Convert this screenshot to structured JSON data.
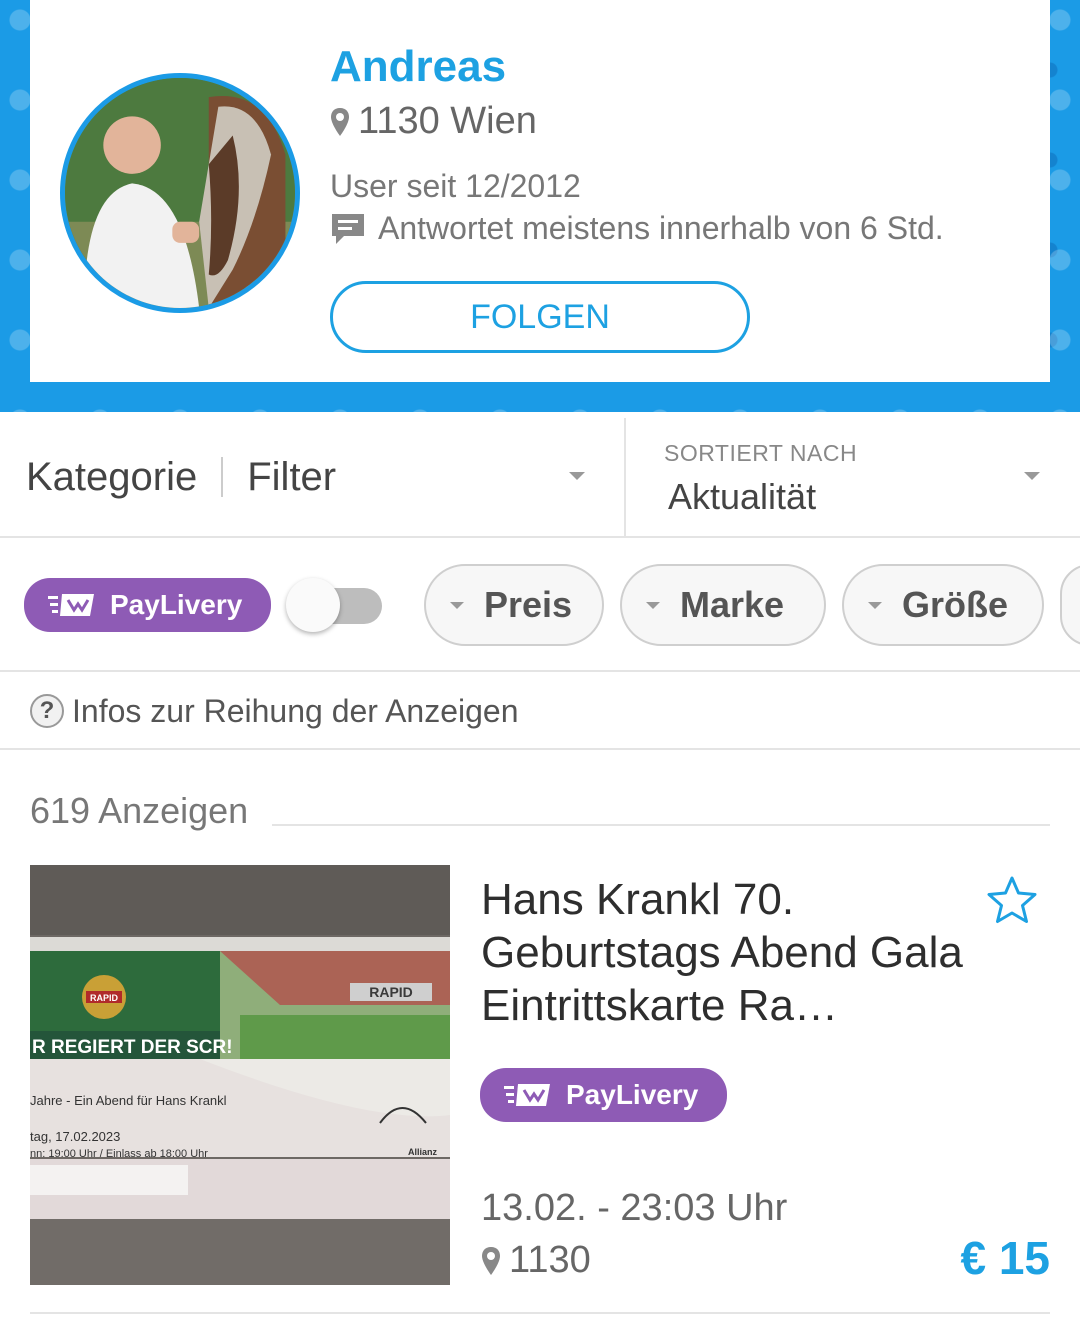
{
  "profile": {
    "name": "Andreas",
    "location": "1130 Wien",
    "member_since": "User seit 12/2012",
    "response_time": "Antwortet meistens innerhalb von 6 Std.",
    "follow_label": "FOLGEN"
  },
  "filters": {
    "category_label": "Kategorie",
    "filter_label": "Filter",
    "sort_caption": "SORTIERT NACH",
    "sort_value": "Aktualität"
  },
  "chips": {
    "paylivery_label": "PayLivery",
    "toggle_on": false,
    "items": [
      {
        "label": "Preis"
      },
      {
        "label": "Marke"
      },
      {
        "label": "Größe"
      }
    ]
  },
  "info": {
    "help_glyph": "?",
    "label": "Infos zur Reihung der Anzeigen"
  },
  "results": {
    "count_label": "619 Anzeigen"
  },
  "listing": {
    "title": "Hans Krankl 70. Geburtstags Abend Gala Eintrittskarte Ra…",
    "badge": "PayLivery",
    "date": "13.02. - 23:03 Uhr",
    "location": "1130",
    "price": "€ 15",
    "image_text": {
      "logo": "RAPID",
      "stadium_sign": "RAPID",
      "slogan": "R REGIERT DER SCR!",
      "event": "Jahre - Ein Abend für Hans Krankl",
      "date": "tag, 17.02.2023",
      "times": "nn: 19:00 Uhr / Einlass ab 18:00 Uhr",
      "sponsor": "Allianz"
    }
  },
  "colors": {
    "accent": "#1da1e2",
    "banner": "#1b9be6",
    "paylivery": "#8e5bb5"
  }
}
